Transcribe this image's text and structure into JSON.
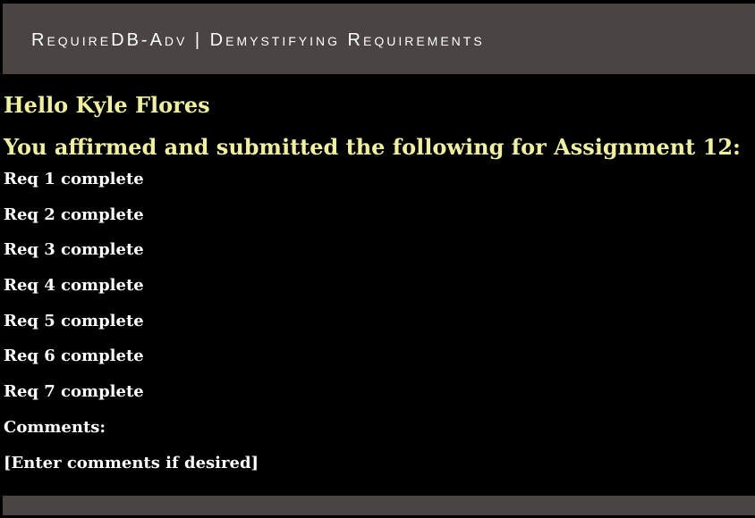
{
  "header": {
    "title": "RequireDB-Adv | Demystifying Requirements"
  },
  "main": {
    "greeting": "Hello Kyle Flores",
    "subtitle": "You affirmed and submitted the following for Assignment 12:",
    "requirements": [
      "Req 1 complete",
      "Req 2 complete",
      "Req 3 complete",
      "Req 4 complete",
      "Req 5 complete",
      "Req 6 complete",
      "Req 7 complete"
    ],
    "comments_label": "Comments:",
    "comments_value": "[Enter comments if desired]"
  },
  "colors": {
    "background": "#000000",
    "banner": "#4a4442",
    "heading": "#f0f0a0",
    "text": "#ffffff"
  }
}
